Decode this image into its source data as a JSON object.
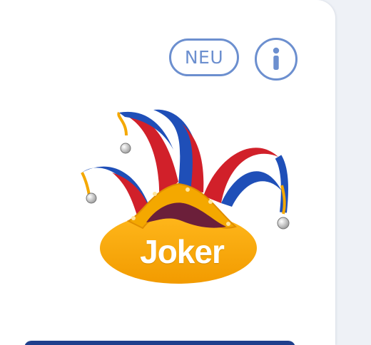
{
  "badge": {
    "label": "NEU"
  },
  "logo": {
    "word": "Joker"
  },
  "colors": {
    "accent_outline": "#6c8fcf",
    "cap_blue": "#1f4fb8",
    "cap_red": "#d1202a",
    "cap_yellow": "#f4a800",
    "bottom_bar": "#1f3f8c"
  },
  "icons": {
    "info": "info-icon",
    "logo": "jester-hat-icon"
  }
}
